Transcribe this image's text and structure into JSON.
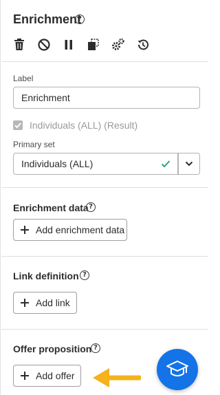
{
  "header": {
    "title": "Enrichment"
  },
  "toolbar": {
    "icons": [
      "trash-icon",
      "ban-icon",
      "pause-icon",
      "copy-icon",
      "settings-icon",
      "history-icon"
    ]
  },
  "form": {
    "label_caption": "Label",
    "label_value": "Enrichment",
    "checkbox_label": "Individuals (ALL) (Result)",
    "checkbox_checked": true,
    "primary_set_caption": "Primary set",
    "primary_set_value": "Individuals (ALL)"
  },
  "enrichment_data": {
    "title": "Enrichment data",
    "button": "Add enrichment data"
  },
  "link_definition": {
    "title": "Link definition",
    "button": "Add link"
  },
  "offer_proposition": {
    "title": "Offer proposition",
    "button": "Add offer"
  },
  "colors": {
    "accent": "#1473e6",
    "check": "#2d9d78",
    "arrow": "#f5b21a"
  }
}
